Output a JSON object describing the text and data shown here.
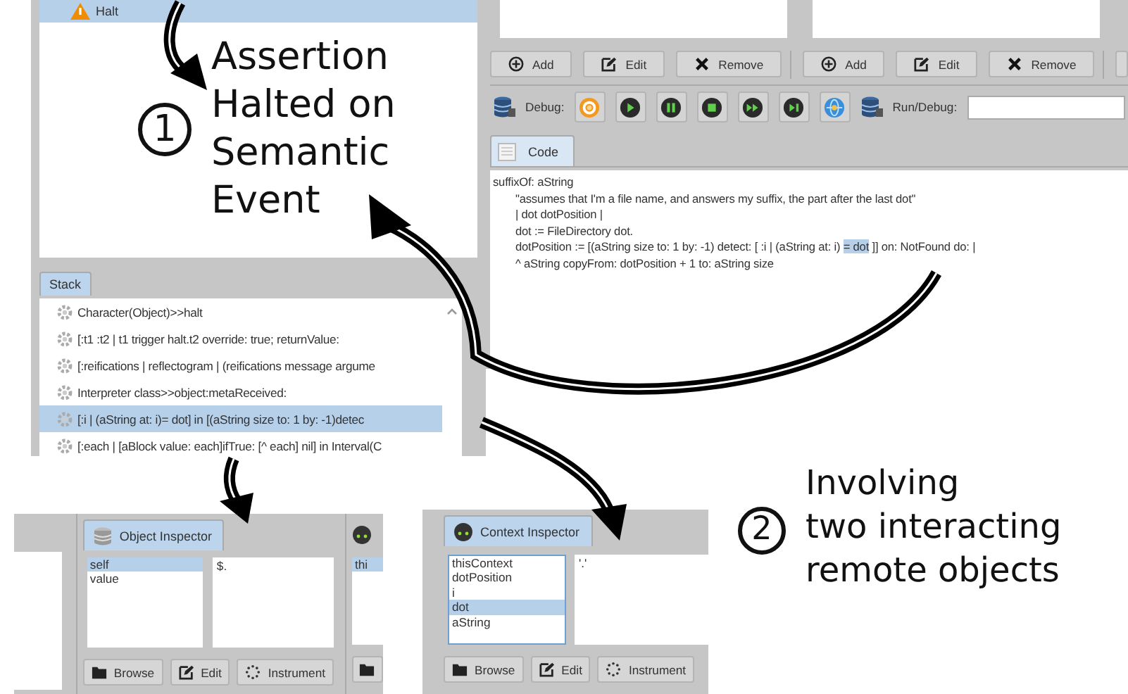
{
  "halt_list": {
    "items": [
      {
        "label": "Halt",
        "selected": true
      }
    ]
  },
  "annotations": [
    {
      "number": "1",
      "lines": [
        "Assertion",
        "Halted on",
        "Semantic",
        "Event"
      ]
    },
    {
      "number": "2",
      "lines": [
        "Involving",
        "two interacting",
        "remote objects"
      ]
    }
  ],
  "stack": {
    "tab": "Stack",
    "rows": [
      {
        "text": "Character(Object)>>halt",
        "selected": false
      },
      {
        "text": "[:t1 :t2 | t1 trigger halt.t2 override: true; returnValue:",
        "selected": false
      },
      {
        "text": "[:reifications | reflectogram | (reifications message argume",
        "selected": false
      },
      {
        "text": "Interpreter class>>object:metaReceived:",
        "selected": false
      },
      {
        "text": "[:i | (aString at: i)= dot] in [(aString size to: 1 by: -1)detec",
        "selected": true
      },
      {
        "text": "[:each | [aBlock value: each]ifTrue: [^ each] nil] in Interval(C",
        "selected": false
      }
    ]
  },
  "editor": {
    "button_groups": [
      [
        {
          "kind": "add",
          "label": "Add"
        },
        {
          "kind": "edit",
          "label": "Edit"
        },
        {
          "kind": "remove",
          "label": "Remove"
        }
      ],
      [
        {
          "kind": "add",
          "label": "Add"
        },
        {
          "kind": "edit",
          "label": "Edit"
        },
        {
          "kind": "remove",
          "label": "Remove"
        }
      ]
    ],
    "debug_label": "Debug:",
    "debug_buttons": [
      {
        "kind": "refresh"
      },
      {
        "kind": "play"
      },
      {
        "kind": "pause"
      },
      {
        "kind": "stop"
      },
      {
        "kind": "fast-forward"
      },
      {
        "kind": "skip"
      },
      {
        "kind": "globe"
      }
    ],
    "run_debug_label": "Run/Debug:",
    "code_tab": "Code",
    "code": {
      "signature": "suffixOf: aString",
      "body": [
        {
          "before": "\"assumes that I'm a file name, and answers my suffix, the part after the last dot\""
        },
        {
          "before": "| dot dotPosition |"
        },
        {
          "before": "dot := FileDirectory dot."
        },
        {
          "before": "dotPosition := [(aString size to: 1 by:  -1) detect: [ :i | (aString at: i) ",
          "highlight": "= dot",
          "after": " ]] on: NotFound do: |"
        },
        {
          "before": "^ aString copyFrom: dotPosition + 1  to: aString size"
        }
      ]
    }
  },
  "object_inspector": {
    "tab": "Object Inspector",
    "variables": [
      {
        "name": "self",
        "selected": true
      },
      {
        "name": "value",
        "selected": false
      }
    ],
    "value": "$.",
    "buttons": [
      {
        "kind": "browse",
        "label": "Browse"
      },
      {
        "kind": "edit",
        "label": "Edit"
      },
      {
        "kind": "instrument",
        "label": "Instrument"
      }
    ]
  },
  "partial_inspector": {
    "variables": [
      {
        "name": "thi",
        "selected": true
      }
    ]
  },
  "context_inspector": {
    "tab": "Context Inspector",
    "variables": [
      {
        "name": "thisContext",
        "selected": false
      },
      {
        "name": "dotPosition",
        "selected": false
      },
      {
        "name": "i",
        "selected": false
      },
      {
        "name": "dot",
        "selected": true
      },
      {
        "name": "aString",
        "selected": false
      }
    ],
    "value": "'.'",
    "buttons": [
      {
        "kind": "browse",
        "label": "Browse"
      },
      {
        "kind": "edit",
        "label": "Edit"
      },
      {
        "kind": "instrument",
        "label": "Instrument"
      }
    ]
  }
}
